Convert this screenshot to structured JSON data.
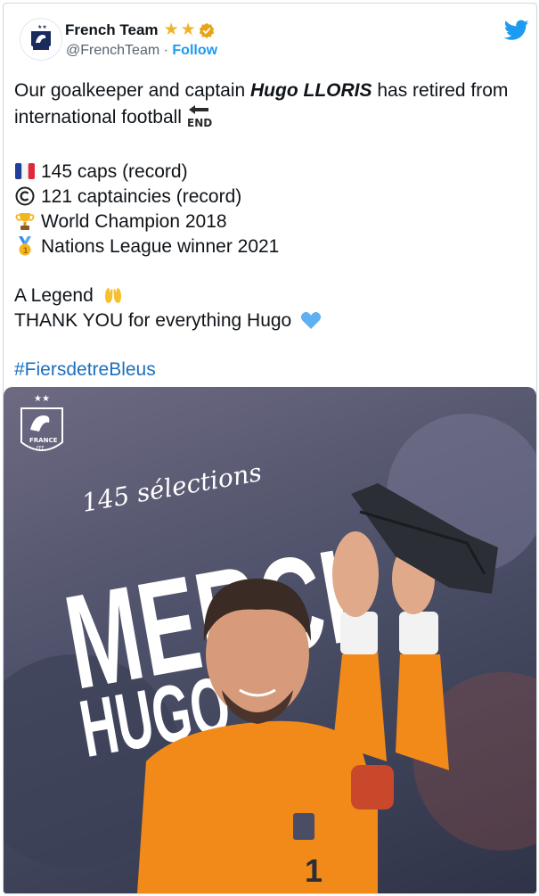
{
  "tweet": {
    "author_name": "French Team",
    "handle": "@FrenchTeam",
    "separator": "·",
    "follow_label": "Follow",
    "intro_part1": "Our goalkeeper and captain ",
    "player_name": "Hugo LLORIS",
    "intro_part2": " has retired from international football",
    "end_label": "END",
    "stats": [
      {
        "icon": "french-flag-icon",
        "text": "145 caps (record)"
      },
      {
        "icon": "copyright-icon",
        "text": "121 captaincies (record)"
      },
      {
        "icon": "trophy-icon",
        "text": "World Champion 2018"
      },
      {
        "icon": "medal-icon",
        "text": "Nations League winner 2021"
      }
    ],
    "legend_line": "A Legend",
    "thanks_line": "THANK YOU for everything Hugo",
    "hashtag": "#FiersdetreBleus"
  },
  "media": {
    "caption": "145 sélections",
    "title_top": "MERCI",
    "title_bottom": "HUGO",
    "badge_label": "FRANCE",
    "badge_sub": "FFF",
    "jersey_color": "#f28a1a",
    "background_color": "#4c5068"
  },
  "colors": {
    "accent": "#1d9bf0",
    "star": "#f0b429",
    "verified": "#e8a317",
    "hashtag": "#1b6fbf"
  }
}
